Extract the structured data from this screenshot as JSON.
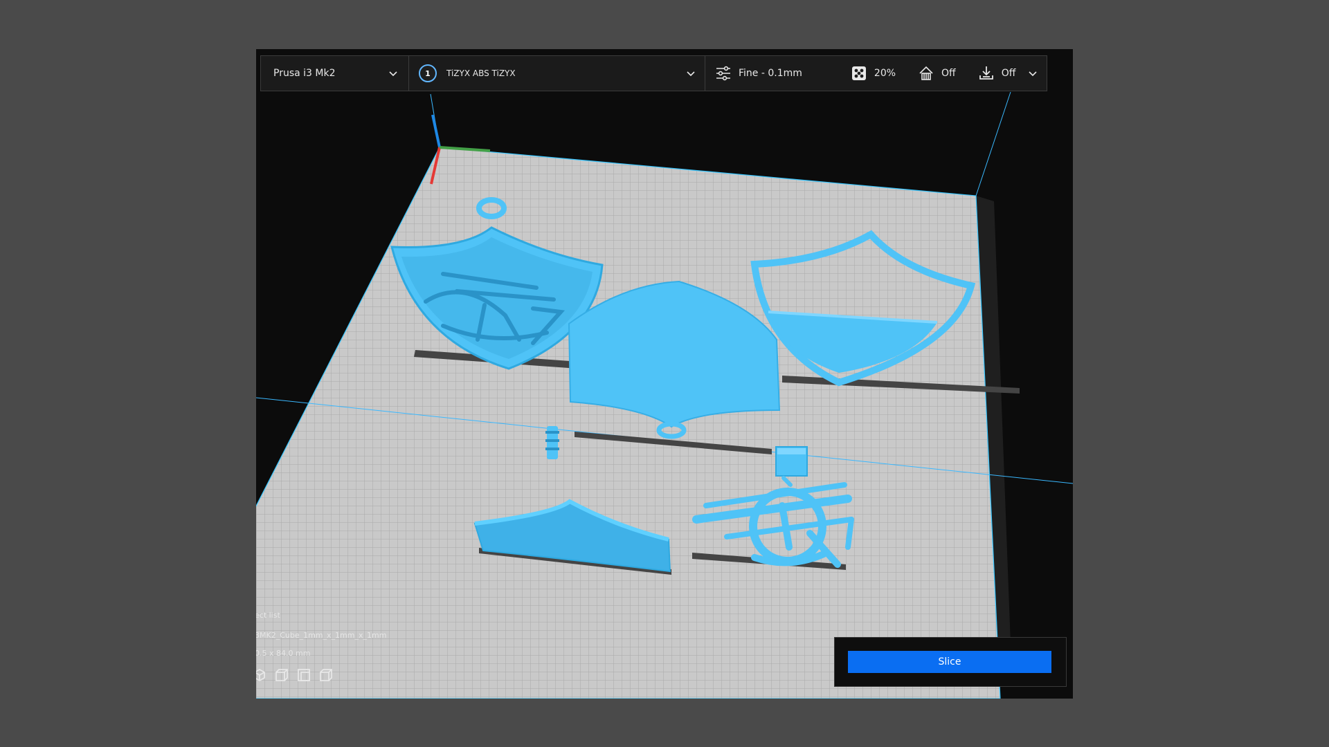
{
  "toolbar": {
    "printer": "Prusa i3 Mk2",
    "material": {
      "extruder_number": "1",
      "name": "TiZYX ABS TiZYX"
    },
    "settings": {
      "profile": "Fine - 0.1mm",
      "infill": "20%",
      "support": "Off",
      "adhesion": "Off"
    }
  },
  "object_info": {
    "list_label": "ect list",
    "selected_object": "3MK2_Cube_1mm_x_1mm_x_1mm",
    "dimensions": "0.5 x 84.0 mm"
  },
  "slice_panel": {
    "button_label": "Slice"
  },
  "colors": {
    "model": "#4fc3f7",
    "accent": "#0a6ef2",
    "build_plate": "#c8c8c8",
    "axis_x": "#e53935",
    "axis_y": "#43a047",
    "axis_z": "#1e88e5"
  }
}
